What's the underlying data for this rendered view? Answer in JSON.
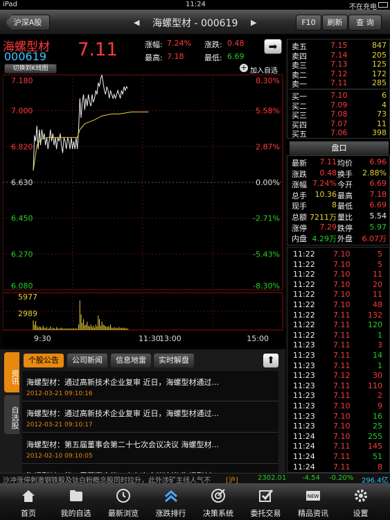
{
  "status": {
    "device": "iPad",
    "time": "11:24",
    "battery": "不在充电"
  },
  "nav": {
    "market_button": "沪深A股",
    "title": "海螺型材 - 000619",
    "f10": "F10",
    "refresh": "刷新",
    "query": "查 询"
  },
  "stock": {
    "name": "海螺型材",
    "code": "000619",
    "price": "7.11",
    "chg_pct_label": "涨幅:",
    "chg_pct": "7.24%",
    "chg_label": "涨跌:",
    "chg": "0.48",
    "high_label": "最高:",
    "high": "7.18",
    "low_label": "最低:",
    "low": "6.69",
    "kline_button": "切换到K线图",
    "add_fav": "加入自选"
  },
  "chart_data": {
    "type": "line",
    "price_ticks": [
      "7.180",
      "7.000",
      "6.820",
      "6.630",
      "6.450",
      "6.270",
      "6.080"
    ],
    "pct_ticks": [
      "8.30%",
      "5.58%",
      "2.87%",
      "0.00%",
      "-2.71%",
      "-5.43%",
      "-8.30%"
    ],
    "volume_ticks": [
      "5977",
      "2989"
    ],
    "time_ticks": [
      "9:30",
      "11:30",
      "13:00",
      "15:00"
    ],
    "ylim": [
      6.08,
      7.18
    ],
    "prev_close": 6.63,
    "volume_max": 5977,
    "minutes": 120,
    "price": [
      [
        0,
        6.69
      ],
      [
        1,
        6.87
      ],
      [
        2,
        6.84
      ],
      [
        3,
        6.92
      ],
      [
        4,
        6.8
      ],
      [
        5,
        6.9
      ],
      [
        6,
        6.82
      ],
      [
        7,
        6.9
      ],
      [
        8,
        6.85
      ],
      [
        9,
        6.88
      ],
      [
        10,
        6.82
      ],
      [
        11,
        6.86
      ],
      [
        12,
        6.8
      ],
      [
        13,
        6.84
      ],
      [
        14,
        6.9
      ],
      [
        15,
        6.84
      ],
      [
        16,
        6.88
      ],
      [
        17,
        6.82
      ],
      [
        18,
        6.86
      ],
      [
        19,
        6.8
      ],
      [
        20,
        6.86
      ],
      [
        21,
        6.84
      ],
      [
        22,
        6.88
      ],
      [
        23,
        6.82
      ],
      [
        24,
        6.78
      ],
      [
        25,
        6.86
      ],
      [
        26,
        6.84
      ],
      [
        27,
        6.8
      ],
      [
        28,
        6.86
      ],
      [
        29,
        6.84
      ],
      [
        30,
        6.8
      ],
      [
        31,
        6.86
      ],
      [
        32,
        6.8
      ],
      [
        33,
        6.84
      ],
      [
        34,
        6.8
      ],
      [
        35,
        6.86
      ],
      [
        36,
        6.8
      ],
      [
        37,
        6.9
      ],
      [
        38,
        7.06
      ],
      [
        39,
        6.96
      ],
      [
        40,
        7.04
      ],
      [
        41,
        7.08
      ],
      [
        42,
        7.0
      ],
      [
        43,
        7.06
      ],
      [
        44,
        7.02
      ],
      [
        45,
        7.08
      ],
      [
        46,
        7.04
      ],
      [
        47,
        7.02
      ],
      [
        48,
        7.08
      ],
      [
        49,
        7.04
      ],
      [
        50,
        7.06
      ],
      [
        51,
        7.1
      ],
      [
        52,
        7.08
      ],
      [
        53,
        7.14
      ],
      [
        54,
        7.12
      ],
      [
        55,
        7.16
      ],
      [
        56,
        7.18
      ],
      [
        57,
        7.14
      ],
      [
        58,
        7.1
      ],
      [
        59,
        7.08
      ],
      [
        60,
        7.12
      ],
      [
        61,
        7.1
      ],
      [
        62,
        7.06
      ],
      [
        63,
        7.1
      ],
      [
        64,
        7.08
      ],
      [
        65,
        7.06
      ],
      [
        66,
        7.08
      ],
      [
        67,
        7.06
      ],
      [
        68,
        7.08
      ],
      [
        69,
        7.1
      ],
      [
        70,
        7.08
      ],
      [
        71,
        7.06
      ],
      [
        72,
        7.1
      ],
      [
        73,
        7.08
      ],
      [
        74,
        7.12
      ],
      [
        75,
        7.1
      ],
      [
        76,
        7.12
      ],
      [
        77,
        7.11
      ]
    ],
    "avg": [
      [
        0,
        6.69
      ],
      [
        3,
        6.82
      ],
      [
        6,
        6.85
      ],
      [
        12,
        6.86
      ],
      [
        20,
        6.86
      ],
      [
        30,
        6.86
      ],
      [
        36,
        6.86
      ],
      [
        38,
        6.9
      ],
      [
        42,
        6.93
      ],
      [
        50,
        6.95
      ],
      [
        56,
        6.97
      ],
      [
        64,
        6.98
      ],
      [
        70,
        6.98
      ],
      [
        80,
        6.99
      ],
      [
        90,
        6.99
      ],
      [
        94,
        6.99
      ]
    ],
    "volume": [
      [
        0,
        1600
      ],
      [
        1,
        900
      ],
      [
        2,
        1500
      ],
      [
        3,
        700
      ],
      [
        4,
        400
      ],
      [
        5,
        600
      ],
      [
        6,
        500
      ],
      [
        7,
        300
      ],
      [
        8,
        700
      ],
      [
        9,
        400
      ],
      [
        10,
        300
      ],
      [
        11,
        500
      ],
      [
        12,
        200
      ],
      [
        13,
        300
      ],
      [
        14,
        600
      ],
      [
        15,
        200
      ],
      [
        16,
        400
      ],
      [
        17,
        300
      ],
      [
        18,
        200
      ],
      [
        19,
        500
      ],
      [
        20,
        300
      ],
      [
        21,
        200
      ],
      [
        22,
        300
      ],
      [
        23,
        400
      ],
      [
        24,
        200
      ],
      [
        25,
        300
      ],
      [
        26,
        200
      ],
      [
        27,
        300
      ],
      [
        28,
        200
      ],
      [
        29,
        300
      ],
      [
        30,
        200
      ],
      [
        31,
        300
      ],
      [
        32,
        200
      ],
      [
        33,
        300
      ],
      [
        34,
        200
      ],
      [
        35,
        300
      ],
      [
        36,
        200
      ],
      [
        37,
        900
      ],
      [
        38,
        4900
      ],
      [
        39,
        2600
      ],
      [
        40,
        1200
      ],
      [
        41,
        1800
      ],
      [
        42,
        800
      ],
      [
        43,
        900
      ],
      [
        44,
        1400
      ],
      [
        45,
        700
      ],
      [
        46,
        600
      ],
      [
        47,
        900
      ],
      [
        48,
        500
      ],
      [
        49,
        700
      ],
      [
        50,
        400
      ],
      [
        51,
        900
      ],
      [
        52,
        600
      ],
      [
        53,
        2400
      ],
      [
        54,
        1800
      ],
      [
        55,
        700
      ],
      [
        56,
        1400
      ],
      [
        57,
        900
      ],
      [
        58,
        800
      ],
      [
        59,
        600
      ],
      [
        60,
        500
      ],
      [
        61,
        700
      ],
      [
        62,
        500
      ],
      [
        63,
        900
      ],
      [
        64,
        400
      ],
      [
        65,
        300
      ],
      [
        66,
        500
      ],
      [
        67,
        300
      ],
      [
        68,
        400
      ],
      [
        69,
        300
      ],
      [
        70,
        500
      ],
      [
        71,
        300
      ],
      [
        72,
        400
      ],
      [
        73,
        300
      ],
      [
        74,
        400
      ],
      [
        75,
        300
      ],
      [
        76,
        200
      ],
      [
        77,
        300
      ]
    ]
  },
  "orderbook": {
    "asks": [
      {
        "label": "卖五",
        "price": "7.15",
        "vol": "847"
      },
      {
        "label": "卖四",
        "price": "7.14",
        "vol": "205"
      },
      {
        "label": "卖三",
        "price": "7.13",
        "vol": "125"
      },
      {
        "label": "卖二",
        "price": "7.12",
        "vol": "172"
      },
      {
        "label": "卖一",
        "price": "7.11",
        "vol": "285"
      }
    ],
    "bids": [
      {
        "label": "买一",
        "price": "7.10",
        "vol": "6"
      },
      {
        "label": "买二",
        "price": "7.09",
        "vol": "4"
      },
      {
        "label": "买三",
        "price": "7.08",
        "vol": "73"
      },
      {
        "label": "买四",
        "price": "7.07",
        "vol": "11"
      },
      {
        "label": "买五",
        "price": "7.06",
        "vol": "398"
      }
    ]
  },
  "panel": {
    "title": "盘口",
    "rows": [
      {
        "l1": "最新",
        "v1": "7.11",
        "c1": "red",
        "l2": "均价",
        "v2": "6.96",
        "c2": "red"
      },
      {
        "l1": "涨跌",
        "v1": "0.48",
        "c1": "red",
        "l2": "换手",
        "v2": "2.88%",
        "c2": "yellow"
      },
      {
        "l1": "涨幅",
        "v1": "7.24%",
        "c1": "red",
        "l2": "今开",
        "v2": "6.69",
        "c2": "red"
      },
      {
        "l1": "总手",
        "v1": "10.36",
        "c1": "yellow",
        "l2": "最高",
        "v2": "7.18",
        "c2": "red"
      },
      {
        "l1": "现手",
        "v1": "8",
        "c1": "yellow",
        "l2": "最低",
        "v2": "6.69",
        "c2": "red"
      },
      {
        "l1": "总额",
        "v1": "7211万",
        "c1": "yellow",
        "l2": "量比",
        "v2": "5.54",
        "c2": "white"
      },
      {
        "l1": "涨停",
        "v1": "7.29",
        "c1": "red",
        "l2": "跌停",
        "v2": "5.97",
        "c2": "green"
      },
      {
        "l1": "内盘",
        "v1": "4.29万",
        "c1": "green",
        "l2": "外盘",
        "v2": "6.07万",
        "c2": "red"
      }
    ]
  },
  "ticks": [
    {
      "t": "11:22",
      "p": "7.10",
      "v": "5",
      "c": "red"
    },
    {
      "t": "11:22",
      "p": "7.10",
      "v": "5",
      "c": "red"
    },
    {
      "t": "11:22",
      "p": "7.10",
      "v": "11",
      "c": "red"
    },
    {
      "t": "11:22",
      "p": "7.10",
      "v": "20",
      "c": "red"
    },
    {
      "t": "11:22",
      "p": "7.10",
      "v": "11",
      "c": "red"
    },
    {
      "t": "11:22",
      "p": "7.10",
      "v": "48",
      "c": "red"
    },
    {
      "t": "11:22",
      "p": "7.11",
      "v": "132",
      "c": "red"
    },
    {
      "t": "11:22",
      "p": "7.11",
      "v": "120",
      "c": "green"
    },
    {
      "t": "11:22",
      "p": "7.11",
      "v": "1",
      "c": "green"
    },
    {
      "t": "11:23",
      "p": "7.11",
      "v": "3",
      "c": "red"
    },
    {
      "t": "11:23",
      "p": "7.11",
      "v": "14",
      "c": "green"
    },
    {
      "t": "11:23",
      "p": "7.11",
      "v": "1",
      "c": "green"
    },
    {
      "t": "11:23",
      "p": "7.12",
      "v": "30",
      "c": "red"
    },
    {
      "t": "11:23",
      "p": "7.11",
      "v": "110",
      "c": "red"
    },
    {
      "t": "11:23",
      "p": "7.11",
      "v": "2",
      "c": "red"
    },
    {
      "t": "11:23",
      "p": "7.10",
      "v": "9",
      "c": "red"
    },
    {
      "t": "11:23",
      "p": "7.10",
      "v": "16",
      "c": "green"
    },
    {
      "t": "11:23",
      "p": "7.10",
      "v": "25",
      "c": "green"
    },
    {
      "t": "11:24",
      "p": "7.10",
      "v": "255",
      "c": "green"
    },
    {
      "t": "11:24",
      "p": "7.11",
      "v": "145",
      "c": "red"
    },
    {
      "t": "11:24",
      "p": "7.11",
      "v": "51",
      "c": "green"
    },
    {
      "t": "11:24",
      "p": "7.11",
      "v": "8",
      "c": "red"
    }
  ],
  "news": {
    "side_tabs": [
      "资讯",
      "自选股"
    ],
    "tabs": [
      "个股公告",
      "公司新闻",
      "信息地雷",
      "实时解盘"
    ],
    "items": [
      {
        "title": "海螺型材：通过高新技术企业复审 近日，海螺型材通过...",
        "date": "2012-03-21 09:10:16"
      },
      {
        "title": "海螺型材：通过高新技术企业复审 近日，海螺型材通过...",
        "date": "2012-03-21 09:10:17"
      },
      {
        "title": "海螺型材：第五届董事会第二十七次会议决议 海螺型材...",
        "date": "2012-02-10 09:10:05"
      },
      {
        "title": "海螺型材：第五届董事会第二十七次会议决议 海螺型材...",
        "date": ""
      }
    ]
  },
  "ticker": {
    "text": "沙冲涨停刺激钢铁股及钛白粉概念股同时拉升，此外涉矿主线人气不",
    "market": "[沪]",
    "index": "2302.01",
    "chg": "-4.54",
    "pct": "-0.20%",
    "amount": "296.4亿"
  },
  "tabbar": [
    {
      "label": "首页",
      "icon": "home-icon"
    },
    {
      "label": "我的自选",
      "icon": "folder-icon"
    },
    {
      "label": "最新浏览",
      "icon": "clock-icon"
    },
    {
      "label": "涨跌排行",
      "icon": "chevrons-up-icon"
    },
    {
      "label": "决策系统",
      "icon": "target-icon"
    },
    {
      "label": "委托交易",
      "icon": "checkbox-icon"
    },
    {
      "label": "精品资讯",
      "icon": "news-icon"
    },
    {
      "label": "设置",
      "icon": "gear-icon"
    }
  ],
  "colors": {
    "up": "#ff3a3a",
    "down": "#23d123",
    "avg_line": "#e5d23a",
    "accent_tab": "#e8880f"
  }
}
